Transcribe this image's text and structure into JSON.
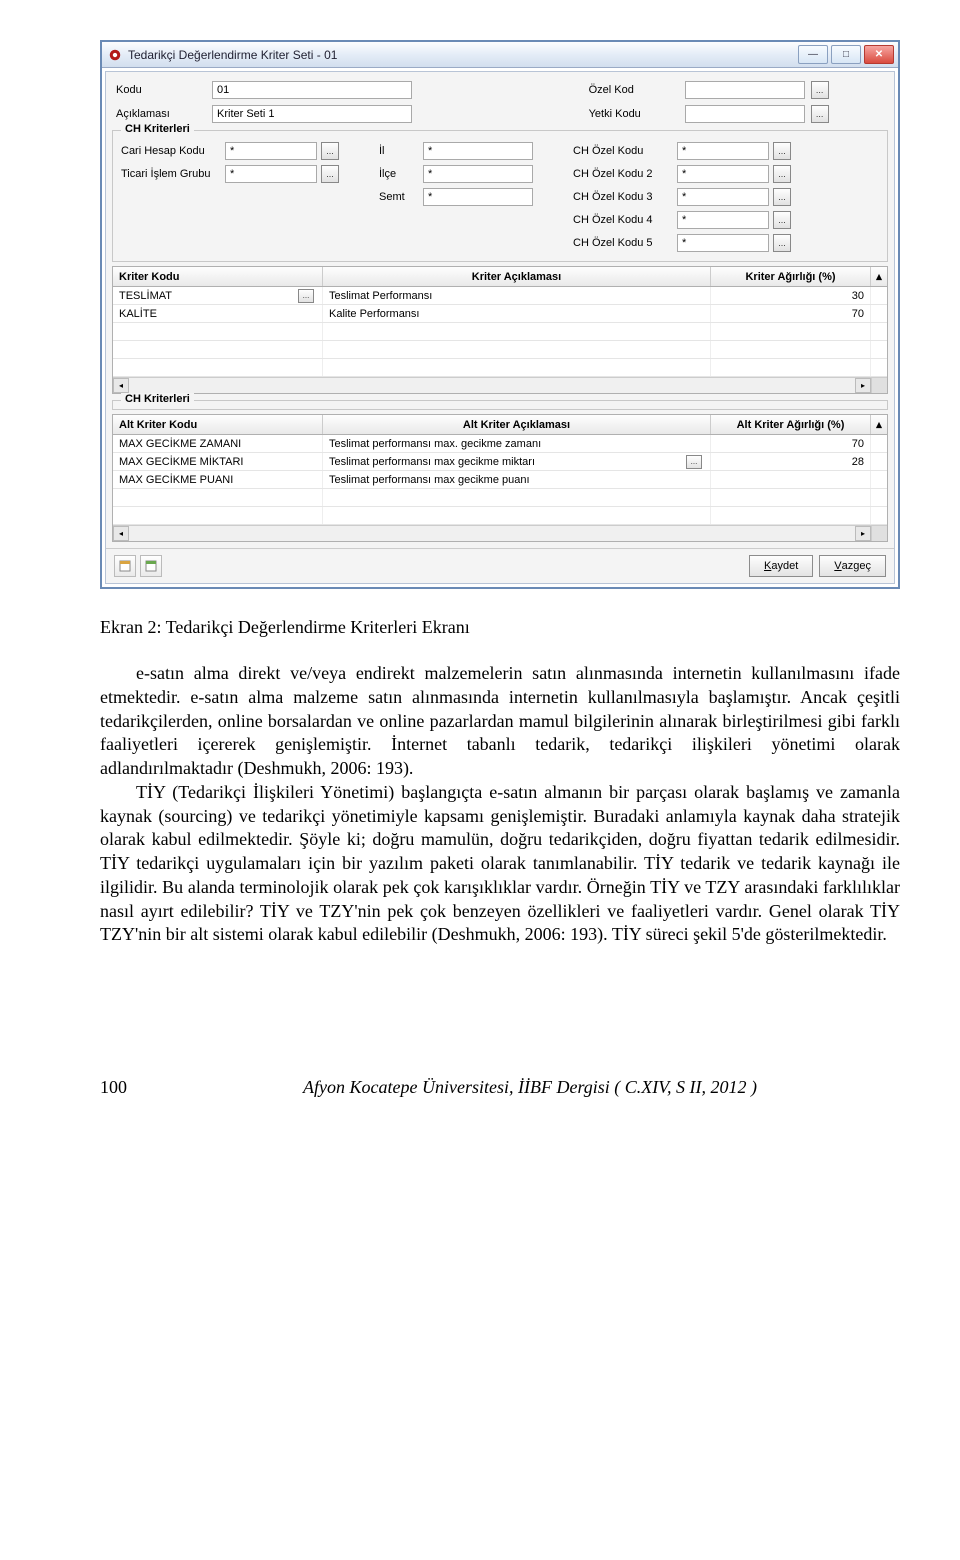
{
  "window": {
    "title": "Tedarikçi Değerlendirme Kriter Seti - 01",
    "minimize_glyph": "—",
    "maximize_glyph": "□",
    "close_glyph": "✕"
  },
  "form_top": {
    "kodu_lbl": "Kodu",
    "kodu_val": "01",
    "aciklamasi_lbl": "Açıklaması",
    "aciklamasi_val": "Kriter Seti 1",
    "ozel_kod_lbl": "Özel Kod",
    "ozel_kod_val": "",
    "yetki_kodu_lbl": "Yetki Kodu",
    "yetki_kodu_val": "",
    "dots": "..."
  },
  "ch_group": {
    "legend": "CH Kriterleri",
    "cari_hesap_lbl": "Cari Hesap Kodu",
    "cari_hesap_val": "*",
    "ticari_islem_lbl": "Ticari İşlem Grubu",
    "ticari_islem_val": "*",
    "il_lbl": "İl",
    "il_val": "*",
    "ilce_lbl": "İlçe",
    "ilce_val": "*",
    "semt_lbl": "Semt",
    "semt_val": "*",
    "ozel1_lbl": "CH Özel Kodu",
    "ozel1_val": "*",
    "ozel2_lbl": "CH Özel Kodu 2",
    "ozel2_val": "*",
    "ozel3_lbl": "CH Özel Kodu 3",
    "ozel3_val": "*",
    "ozel4_lbl": "CH Özel Kodu 4",
    "ozel4_val": "*",
    "ozel5_lbl": "CH Özel Kodu 5",
    "ozel5_val": "*",
    "dots": "..."
  },
  "grid1": {
    "h1": "Kriter Kodu",
    "h2": "Kriter Açıklaması",
    "h3": "Kriter Ağırlığı (%)",
    "sc_up": "▴",
    "rows": [
      {
        "c1": "TESLİMAT",
        "dots": "...",
        "c2": "Teslimat Performansı",
        "c3": "30"
      },
      {
        "c1": "KALİTE",
        "c2": "Kalite Performansı",
        "c3": "70"
      }
    ],
    "arrow_l": "◂",
    "arrow_r": "▸"
  },
  "ch_group2_legend": "CH Kriterleri",
  "grid2": {
    "h1": "Alt Kriter Kodu",
    "h2": "Alt Kriter Açıklaması",
    "h3": "Alt Kriter Ağırlığı (%)",
    "sc_up": "▴",
    "rows": [
      {
        "c1": "MAX GECİKME ZAMANI",
        "c2": "Teslimat performansı max. gecikme zamanı",
        "c3": "70"
      },
      {
        "c1": "MAX GECİKME MİKTARI",
        "c2": "Teslimat performansı max gecikme miktarı",
        "dots": "...",
        "c3": "28"
      },
      {
        "c1": "MAX GECİKME PUANI",
        "c2": "Teslimat performansı max gecikme puanı",
        "c3": ""
      }
    ],
    "arrow_l": "◂",
    "arrow_r": "▸"
  },
  "bottom": {
    "kaydet_pre": "K",
    "kaydet_rest": "aydet",
    "vazgec_pre": "V",
    "vazgec_rest": "azgeç"
  },
  "caption": "Ekran 2: Tedarikçi Değerlendirme Kriterleri Ekranı",
  "para1": "e-satın alma direkt ve/veya endirekt malzemelerin satın alınmasında internetin kullanılmasını ifade etmektedir. e-satın alma malzeme satın alınmasında internetin kullanılmasıyla başlamıştır. Ancak çeşitli tedarikçilerden, online borsalardan ve online pazarlardan mamul bilgilerinin alınarak birleştirilmesi gibi farklı faaliyetleri içererek genişlemiştir. İnternet tabanlı tedarik, tedarikçi ilişkileri yönetimi olarak adlandırılmaktadır (Deshmukh, 2006: 193).",
  "para2": "TİY (Tedarikçi İlişkileri Yönetimi) başlangıçta e-satın almanın bir parçası olarak başlamış ve zamanla kaynak (sourcing) ve tedarikçi yönetimiyle kapsamı genişlemiştir. Buradaki anlamıyla kaynak daha stratejik olarak kabul edilmektedir. Şöyle ki; doğru mamulün, doğru tedarikçiden, doğru fiyattan tedarik edilmesidir. TİY tedarikçi uygulamaları için bir yazılım paketi olarak tanımlanabilir. TİY tedarik ve tedarik kaynağı ile ilgilidir. Bu alanda terminolojik olarak pek çok karışıklıklar vardır. Örneğin TİY ve TZY arasındaki farklılıklar nasıl ayırt edilebilir? TİY ve TZY'nin pek çok benzeyen özellikleri ve faaliyetleri vardır. Genel olarak TİY TZY'nin bir alt sistemi olarak kabul edilebilir (Deshmukh, 2006: 193). TİY süreci şekil 5'de gösterilmektedir.",
  "footer": {
    "page": "100",
    "journal": "Afyon Kocatepe Üniversitesi, İİBF Dergisi ( C.XIV, S II, 2012 )"
  }
}
